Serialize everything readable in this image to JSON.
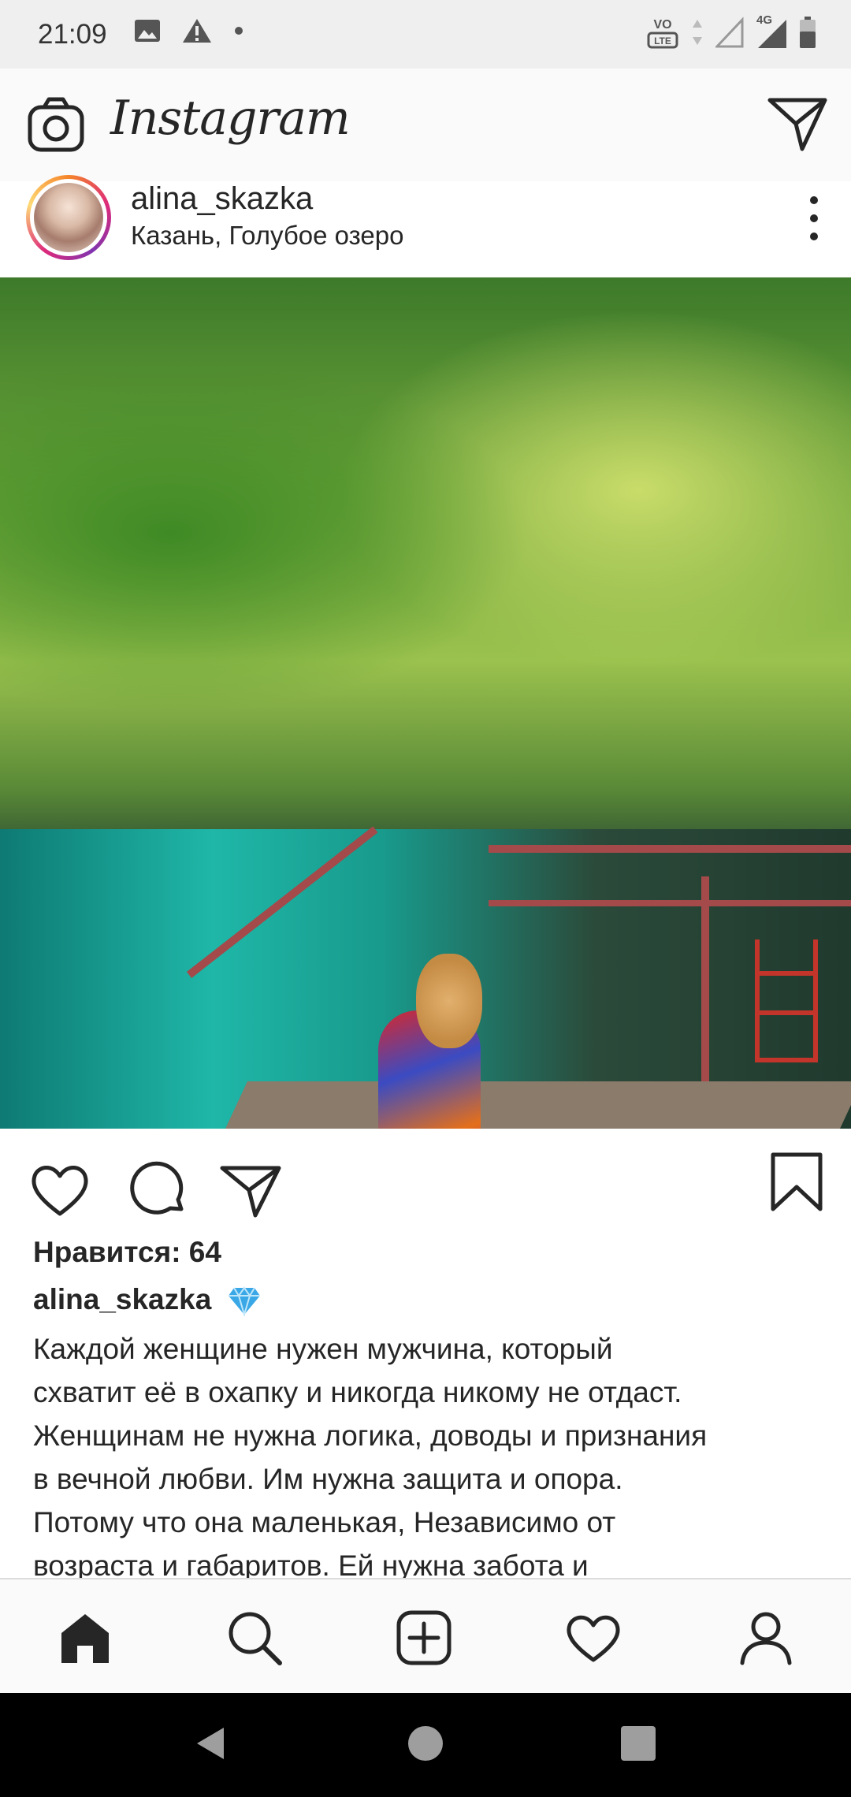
{
  "status_bar": {
    "time": "21:09",
    "left_icons": [
      "image-icon",
      "warning-icon",
      "dot-icon"
    ],
    "right_icons": [
      "volte-icon",
      "data-arrows-icon",
      "signal-empty-icon",
      "signal-4g-icon",
      "battery-icon"
    ],
    "network_label": "4G",
    "volte_label": "VoLTE"
  },
  "top_nav": {
    "logo": "Instagram",
    "left_icon": "camera-icon",
    "right_icon": "direct-message-icon"
  },
  "post": {
    "username": "alina_skazka",
    "location": "Казань, Голубое озеро",
    "photo_alt": "Woman in colorful wrap dress on wooden pier by turquoise lake in green forest",
    "likes_text": "Нравится: 64",
    "caption_user": "alina_skazka",
    "caption_emoji": "gem-icon",
    "caption_text": "Каждой женщине нужен мужчина, который\nсхватит её в охапку и никогда никому не отдаст.\nЖенщинам не нужна логика, доводы и признания\nв вечной любви. Им нужна защита и опора.\nПотому что она маленькая, Независимо от\nвозраста и габаритов. Ей нужна забота и"
  },
  "bottom_nav": {
    "items": [
      "home-icon",
      "search-icon",
      "add-post-icon",
      "activity-heart-icon",
      "profile-icon"
    ],
    "active": "home-icon"
  },
  "system_nav": {
    "buttons": [
      "back-button",
      "home-button",
      "recents-button"
    ]
  },
  "colors": {
    "text": "#262626",
    "bar_bg": "#fafafa",
    "status_bg": "#efefef",
    "gem": "#3aa8e6",
    "avatar_ring_start": "#f58529",
    "avatar_ring_end": "#dd2a7b"
  }
}
